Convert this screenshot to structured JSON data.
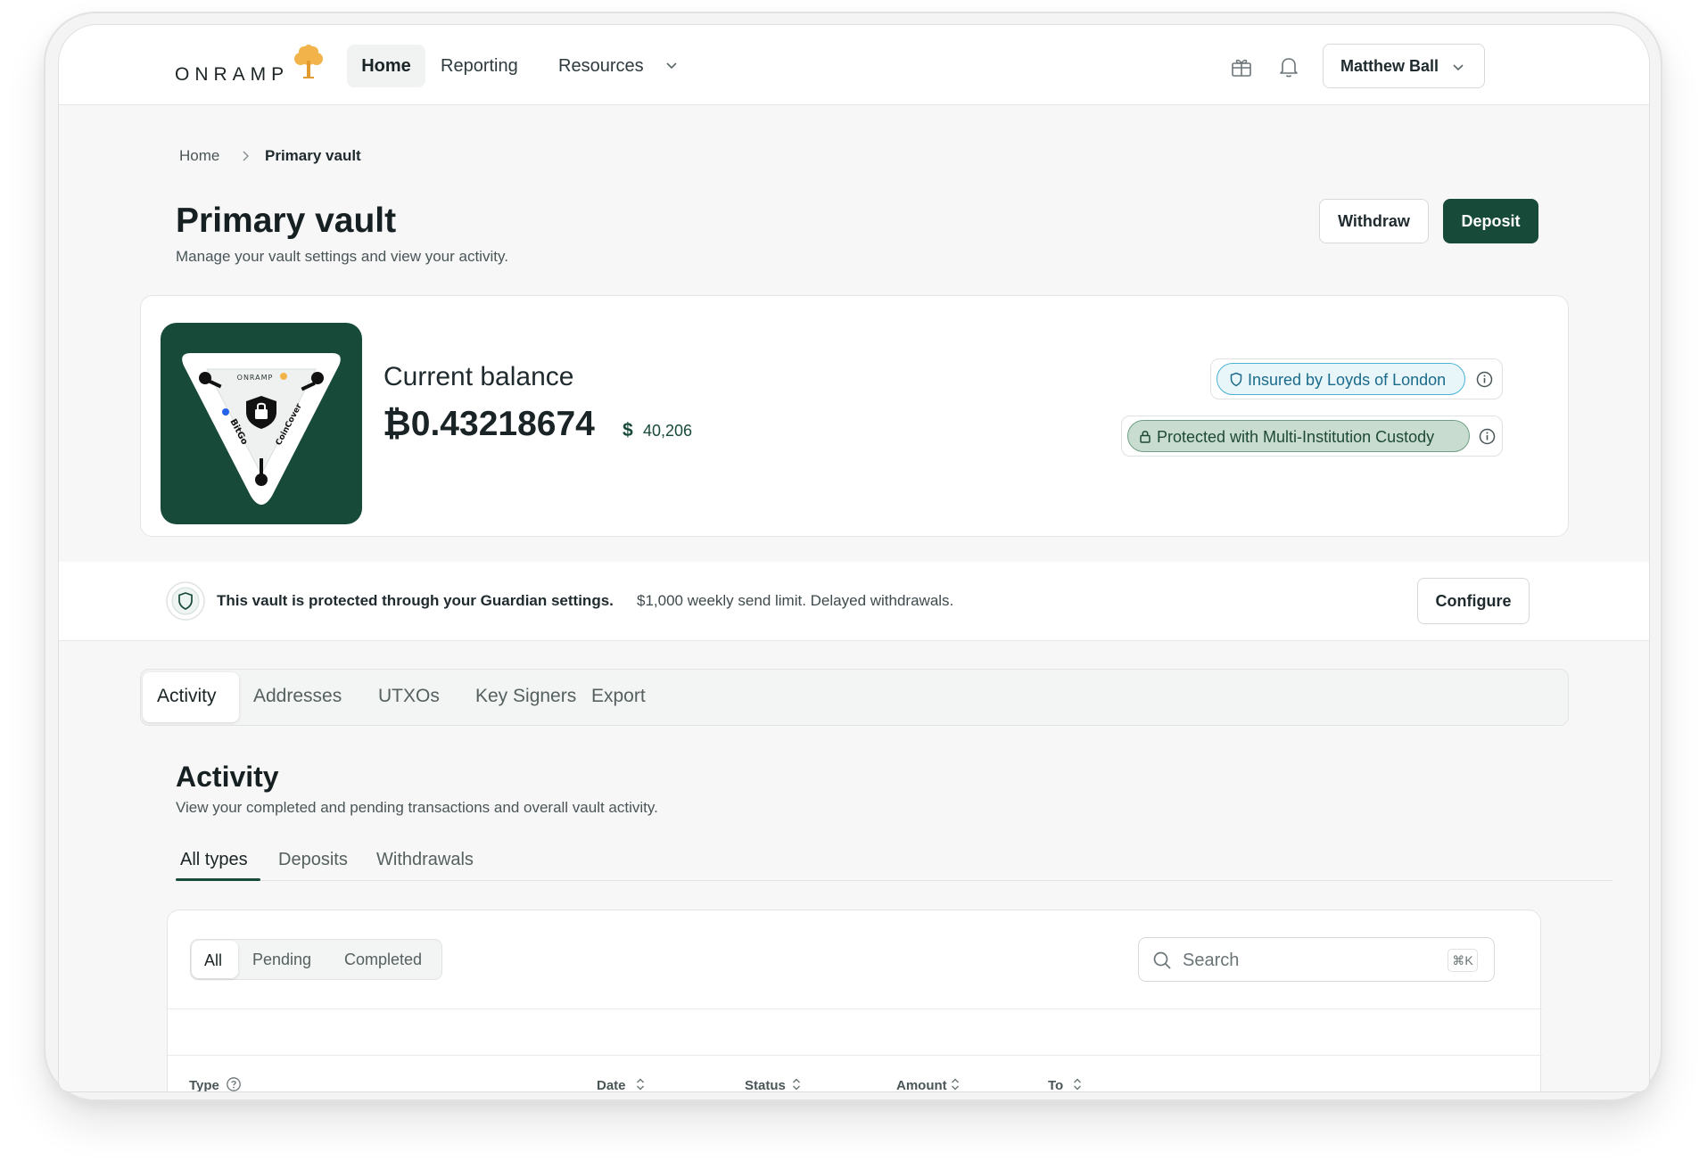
{
  "brand": {
    "name": "ONRAMP"
  },
  "nav": {
    "home": "Home",
    "reporting": "Reporting",
    "resources": "Resources"
  },
  "user": {
    "name": "Matthew Ball"
  },
  "breadcrumb": {
    "home": "Home",
    "current": "Primary vault"
  },
  "page": {
    "title": "Primary vault",
    "subtitle": "Manage your vault settings and view your activity.",
    "withdraw_label": "Withdraw",
    "deposit_label": "Deposit"
  },
  "balance": {
    "label": "Current balance",
    "btc": "₿0.43218674",
    "usd_symbol": "$",
    "usd": "40,206"
  },
  "vault_tile": {
    "brand_small": "ONRAMP",
    "custodian_left": "BitGo",
    "custodian_right": "CoinCover"
  },
  "badges": {
    "insured": "Insured by Loyds of London",
    "protected": "Protected with Multi-Institution Custody"
  },
  "guardian": {
    "bold": "This vault is protected through your Guardian settings.",
    "rest": "$1,000 weekly send limit. Delayed withdrawals.",
    "configure_label": "Configure"
  },
  "tabs": [
    "Activity",
    "Addresses",
    "UTXOs",
    "Key Signers",
    "Export"
  ],
  "activity": {
    "title": "Activity",
    "subtitle": "View your completed and pending transactions and overall vault activity.",
    "subtabs": [
      "All types",
      "Deposits",
      "Withdrawals"
    ]
  },
  "filters": {
    "segments": [
      "All",
      "Pending",
      "Completed"
    ],
    "search_placeholder": "Search",
    "shortcut": "⌘K"
  },
  "table": {
    "columns": [
      "Type",
      "Date",
      "Status",
      "Amount",
      "To"
    ]
  },
  "colors": {
    "brand_green": "#174a38",
    "insured_blue": "#49b2d3",
    "protected_green": "#c8dccf"
  }
}
